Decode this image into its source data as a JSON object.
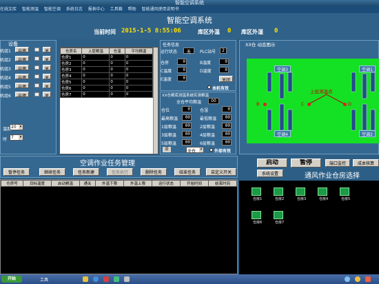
{
  "window_title": "智能空调系统",
  "menu": [
    "在线文库",
    "智能测温",
    "智能空调",
    "系统日志",
    "报表中心",
    "工具箱",
    "帮助",
    "智能通风使用说明书"
  ],
  "app_title": "智能空调系统",
  "status": {
    "time_label": "当前时间",
    "time_value": "2015-1-5 8:55:06",
    "outside_temp_label": "库区外温",
    "outside_temp_value": "0",
    "outside_humidity_label": "库区外湿",
    "outside_humidity_value": "0"
  },
  "left_panel": {
    "title": "设备",
    "groups": [
      {
        "name": "机组1",
        "btn": "启停"
      },
      {
        "name": "机组2",
        "btn": "启停"
      },
      {
        "name": "机组3",
        "btn": "启停"
      },
      {
        "name": "机组4",
        "btn": "启停"
      },
      {
        "name": "机组5",
        "btn": "启停"
      },
      {
        "name": "机组6",
        "btn": "启停"
      }
    ],
    "temp_label": "温度",
    "temp_value": "20",
    "time_label": "时",
    "time_value": "7"
  },
  "bin_table": {
    "headers": [
      "仓房名",
      "上层粮温",
      "仓温",
      "平均粮温"
    ],
    "rows": [
      [
        "仓房1",
        "0",
        "0",
        "0"
      ],
      [
        "仓房2",
        "0",
        "0",
        "0"
      ],
      [
        "仓房3",
        "0",
        "0",
        "0"
      ],
      [
        "仓房4",
        "0",
        "0",
        "0"
      ],
      [
        "仓房5",
        "0",
        "0",
        "0"
      ],
      [
        "仓房6",
        "0",
        "0",
        "0"
      ],
      [
        "仓房7",
        "0",
        "0",
        "0"
      ]
    ]
  },
  "task_info": {
    "title": "任务信息",
    "run_state_label": "运行状态",
    "run_state_value": "无",
    "plc_label": "PLC站号",
    "plc_value": "2",
    "bin_label": "仓房",
    "bin_value": "0",
    "b_temp_label": "B温度",
    "b_temp_value": "0",
    "c_temp_label": "C温度",
    "c_temp_value": "0",
    "d_temp_label": "D温度",
    "d_temp_value": "0",
    "e_temp_label": "E温度",
    "e_temp_value": "0",
    "close_btn": "关闭",
    "local_radio": "本机有效"
  },
  "monitor": {
    "title": "XX仓粮库测温系统实测粮温",
    "avg_label": "全仓平均粮温",
    "avg_value": "00",
    "fields": [
      {
        "l1": "仓位",
        "v1": "0",
        "l2": "仓湿",
        "v2": "0"
      },
      {
        "l1": "最高粮温",
        "v1": "00",
        "l2": "最低粮温",
        "v2": "00"
      },
      {
        "l1": "1层粮温",
        "v1": "00",
        "l2": "2层粮温",
        "v2": "00"
      },
      {
        "l1": "3层粮温",
        "v1": "00",
        "l2": "4层粮温",
        "v2": "00"
      },
      {
        "l1": "5层粮温",
        "v1": "00",
        "l2": "6层粮温",
        "v2": "00"
      }
    ],
    "select_value": "全仓",
    "ext_radio": "外部有效"
  },
  "diagram": {
    "title": "XX仓 动态图示",
    "units": [
      "空调3",
      "空调1",
      "空调4",
      "空调2"
    ],
    "layer_label": "上层测温点",
    "points": [
      "B",
      "C",
      "D"
    ]
  },
  "control": {
    "start_btn": "启动",
    "pause_btn": "暂停",
    "port_btn": "端口监控",
    "cost_btn": "成本核算",
    "settings_btn": "系统设置",
    "select_title": "通风作业仓房选择",
    "bins": [
      "仓房1",
      "仓房2",
      "仓房3",
      "仓房4",
      "仓房5",
      "仓房6",
      "仓房7"
    ]
  },
  "task_mgmt": {
    "title": "空调作业任务管理",
    "buttons": [
      "暂停任务",
      "继续任务",
      "任务新建",
      "任务执行",
      "删除任务",
      "结束任务",
      "自定义开关"
    ],
    "headers": [
      "仓房号",
      "目标温度",
      "启动粮温",
      "通关",
      "外温下限",
      "外温上限",
      "运行状态",
      "开始时间",
      "结束时间"
    ]
  },
  "taskbar": {
    "start": "开始",
    "tools": "工具"
  },
  "colors": {
    "background": "#2d5f86",
    "accent_yellow": "#ffe000",
    "diagram_green": "#14e024",
    "warehouse_green": "#1b9a4a"
  }
}
